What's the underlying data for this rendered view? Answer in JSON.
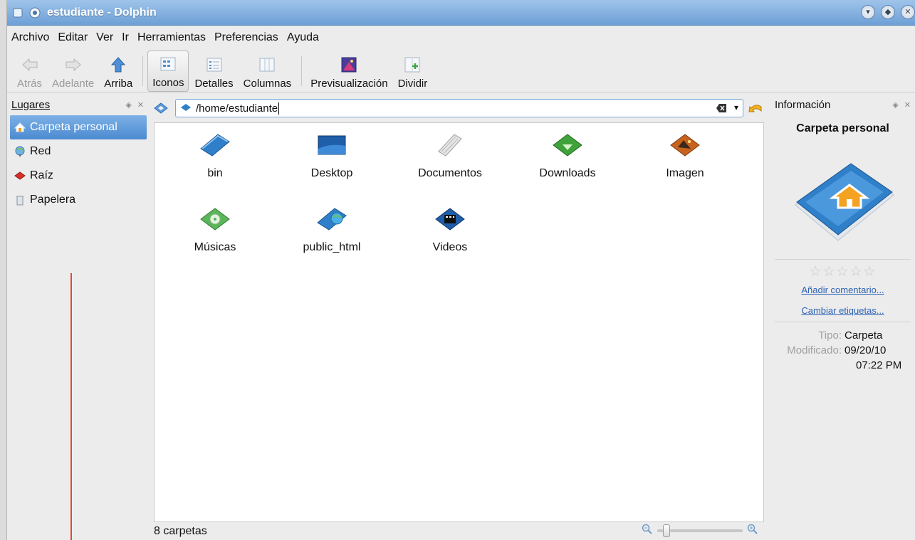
{
  "window": {
    "title": "estudiante - Dolphin"
  },
  "menu": [
    "Archivo",
    "Editar",
    "Ver",
    "Ir",
    "Herramientas",
    "Preferencias",
    "Ayuda"
  ],
  "toolbar": {
    "back": "Atrás",
    "forward": "Adelante",
    "up": "Arriba",
    "icons": "Iconos",
    "details": "Detalles",
    "columns": "Columnas",
    "preview": "Previsualización",
    "split": "Dividir"
  },
  "places": {
    "title": "Lugares",
    "items": [
      {
        "label": "Carpeta personal",
        "icon": "home-icon"
      },
      {
        "label": "Red",
        "icon": "network-icon"
      },
      {
        "label": "Raíz",
        "icon": "root-icon"
      },
      {
        "label": "Papelera",
        "icon": "trash-icon"
      }
    ]
  },
  "location": {
    "path": "/home/estudiante"
  },
  "files": [
    {
      "name": "bin",
      "icon": "folder-icon"
    },
    {
      "name": "Desktop",
      "icon": "desktop-folder-icon"
    },
    {
      "name": "Documentos",
      "icon": "documents-folder-icon"
    },
    {
      "name": "Downloads",
      "icon": "downloads-folder-icon"
    },
    {
      "name": "Imagen",
      "icon": "images-folder-icon"
    },
    {
      "name": "Músicas",
      "icon": "music-folder-icon"
    },
    {
      "name": "public_html",
      "icon": "web-folder-icon"
    },
    {
      "name": "Videos",
      "icon": "video-folder-icon"
    }
  ],
  "status": {
    "text": "8 carpetas"
  },
  "info": {
    "title": "Información",
    "name": "Carpeta personal",
    "add_comment": "Añadir comentario...",
    "change_tags": "Cambiar etiquetas...",
    "type_label": "Tipo:",
    "type_value": "Carpeta",
    "modified_label": "Modificado:",
    "modified_date": "09/20/10",
    "modified_time": "07:22 PM"
  },
  "colors": {
    "titlebar": "#6d9fd6",
    "selection": "#4b8ad0",
    "link": "#2c62b5",
    "folder": "#2f7fc9"
  }
}
